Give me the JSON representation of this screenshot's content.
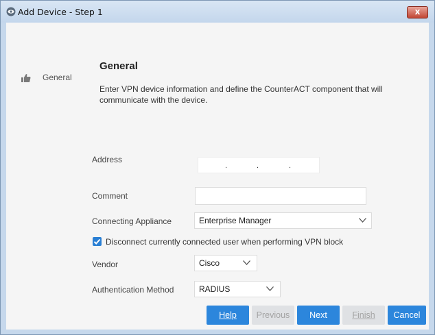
{
  "window": {
    "title": "Add Device - Step 1",
    "icon": "eye-icon",
    "close_label": "x",
    "close_color": "#c14634"
  },
  "nav": {
    "items": [
      {
        "label": "General",
        "icon": "thumbs-up-icon",
        "active": true
      }
    ]
  },
  "section": {
    "title": "General",
    "description": "Enter VPN device information and define the CounterACT component that will communicate with the device."
  },
  "form": {
    "address": {
      "label": "Address",
      "value": ". . ."
    },
    "comment": {
      "label": "Comment",
      "value": ""
    },
    "connecting_appliance": {
      "label": "Connecting Appliance",
      "value": "Enterprise Manager"
    },
    "disconnect": {
      "label": "Disconnect currently connected user when performing VPN block",
      "checked": true
    },
    "vendor": {
      "label": "Vendor",
      "value": "Cisco"
    },
    "auth_method": {
      "label": "Authentication Method",
      "value": "RADIUS"
    }
  },
  "buttons": {
    "help": "Help",
    "previous": "Previous",
    "next": "Next",
    "finish": "Finish",
    "cancel": "Cancel"
  },
  "colors": {
    "accent": "#2c86dc",
    "frame": "#c6d8ec",
    "checkbox": "#2a7fd4"
  }
}
